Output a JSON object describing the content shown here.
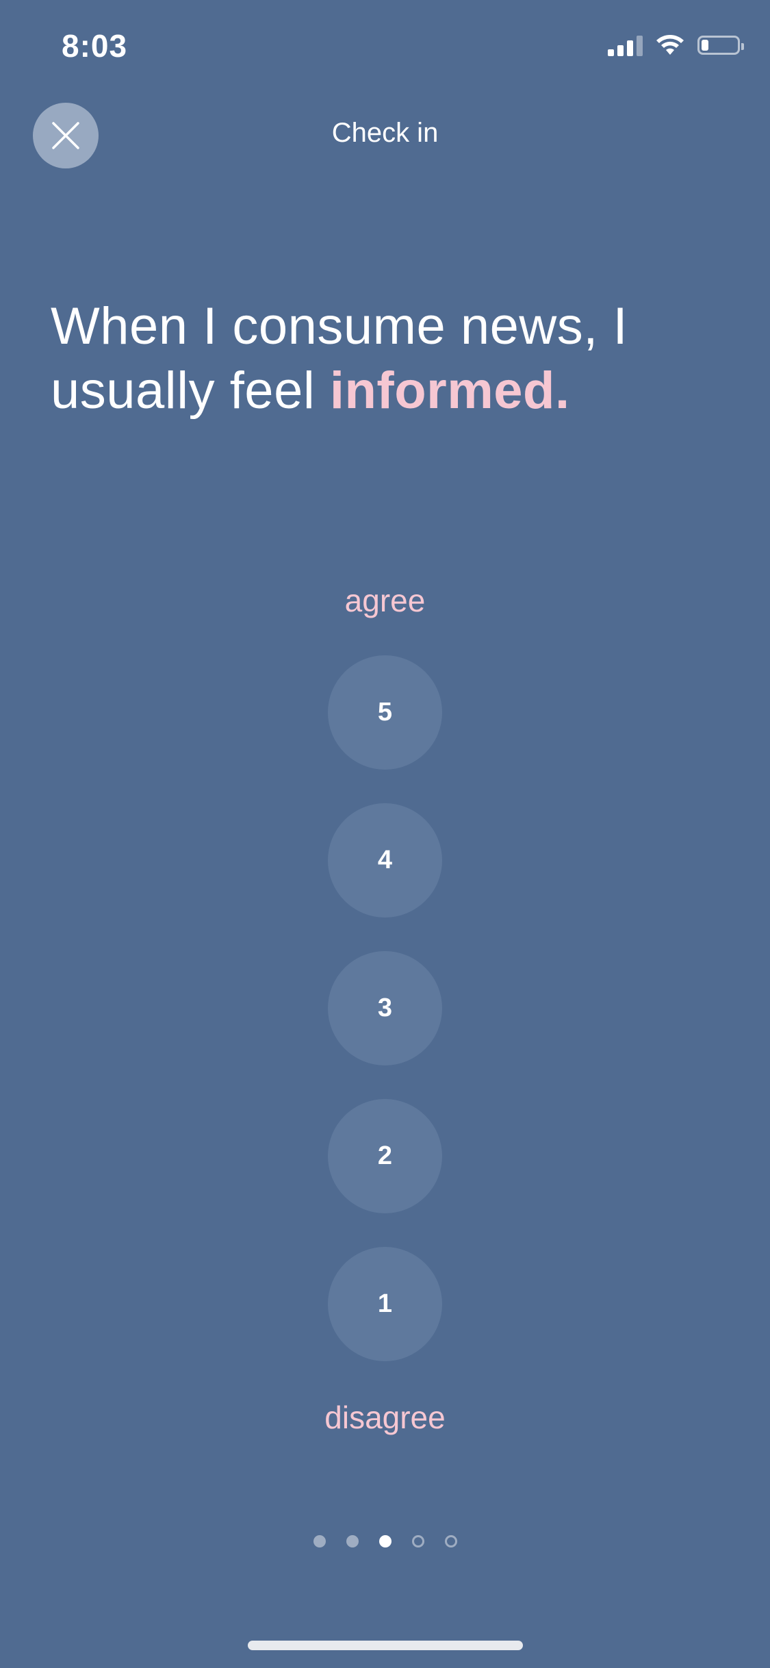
{
  "status_bar": {
    "time": "8:03",
    "battery_level": 0.2
  },
  "header": {
    "close_icon": "close-icon",
    "title": "Check in"
  },
  "question": {
    "text_start": "When I consume news, I usually feel ",
    "text_emphasis": "informed."
  },
  "scale": {
    "top_label": "agree",
    "bottom_label": "disagree",
    "options": [
      "5",
      "4",
      "3",
      "2",
      "1"
    ]
  },
  "pagination": {
    "total": 5,
    "current": 3
  },
  "colors": {
    "background": "#506b91",
    "accent": "#f6c7d2",
    "option_fill": "#5f799d"
  }
}
